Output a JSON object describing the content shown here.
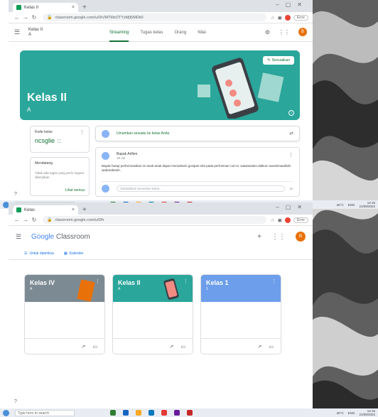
{
  "colors": {
    "accent_green": "#137333",
    "banner_teal": "#2aa69b",
    "avatar_orange": "#e8710a"
  },
  "screen1": {
    "browser": {
      "tab_title": "Kelas II",
      "tab_close": "×",
      "new_tab": "+",
      "url": "classroom.google.com/u/0/c/MTMzOTYzMjI5MDk0",
      "profile_label": "Error"
    },
    "header": {
      "class_name": "Kelas II",
      "class_section": "A",
      "tabs": [
        "Streaming",
        "Tugas kelas",
        "Orang",
        "Nilai"
      ],
      "avatar_letter": "B"
    },
    "banner": {
      "title": "Kelas II",
      "section": "A",
      "customize_label": "Sesuaikan"
    },
    "class_code": {
      "label": "Kode kelas",
      "code": "ncsglie"
    },
    "upcoming": {
      "label": "Mendatang",
      "text": "Tidak ada tugas yang perlu segera dikerjakan",
      "link": "Lihat semua"
    },
    "announce_prompt": "Umumkan sesuatu ke kelas Anda",
    "post": {
      "author": "Bapak Arifien",
      "date": "19 Jul",
      "body": "Bapak harap perfomnasikan ini anak-anak dapat memahami gosipan-nila pada perfomnan nol ini. wawasalam.dalkum warahmatullahi wabaraketuh.",
      "comment_placeholder": "Tambahkan komentar kelas..."
    }
  },
  "taskbar": {
    "search_placeholder": "Type here to search",
    "tray_weather": "26°C",
    "tray_lang": "ENG",
    "time1": "12:15",
    "date1": "21/08/2022",
    "time2": "12:16",
    "date2": "21/08/2022"
  },
  "screen2": {
    "browser": {
      "tab_title": "Kelas",
      "tab_close": "×",
      "new_tab": "+",
      "url": "classroom.google.com/u/0/h",
      "profile_label": "Error"
    },
    "brand": {
      "google": "Google",
      "product": "Classroom"
    },
    "avatar_letter": "B",
    "links": [
      "Untuk diperiksa",
      "Kalender"
    ],
    "cards": [
      {
        "title": "Kelas IV",
        "section": "A",
        "color": "#7c8a93"
      },
      {
        "title": "Kelas II",
        "section": "A",
        "color": "#2aa69b"
      },
      {
        "title": "Kelas 1",
        "section": "1",
        "color": "#6d9eeb"
      }
    ]
  }
}
